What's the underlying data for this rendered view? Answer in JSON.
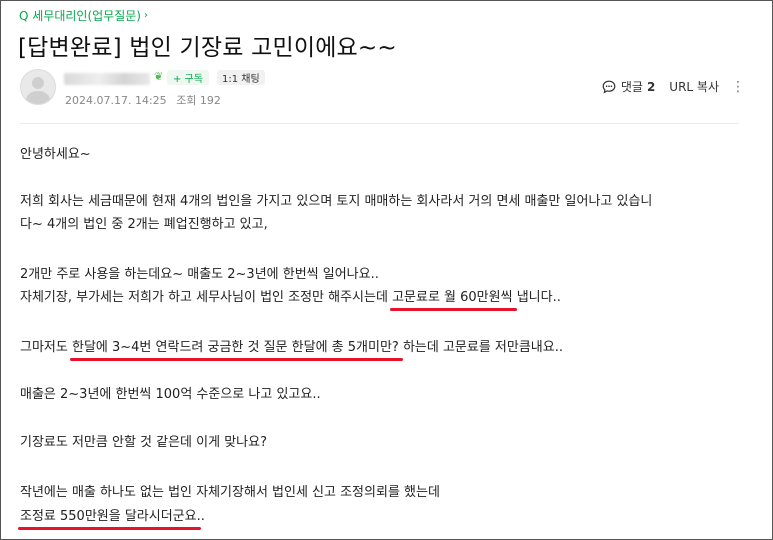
{
  "board": {
    "name": "Q 세무대리인(업무질문)",
    "chevron": "›"
  },
  "post": {
    "title": "[답변완료] 법인 기장료 고민이에요~~"
  },
  "author": {
    "follow_label": "+ 구독",
    "chat_label": "1:1 채팅",
    "date": "2024.07.17. 14:25",
    "views": "조회 192"
  },
  "actions": {
    "comment_label": "댓글",
    "comment_count": "2",
    "url_copy_label": "URL 복사",
    "more_label": "⋮"
  },
  "content": {
    "p1": "안녕하세요~",
    "p2_l1": "저희 회사는 세금때문에 현재 4개의 법인을 가지고 있으며 토지 매매하는 회사라서 거의 면세 매출만 일어나고 있습니",
    "p2_l2": "다~ 4개의 법인 중 2개는 폐업진행하고 있고,",
    "p3_l1": "2개만 주로 사용을 하는데요~ 매출도 2~3년에 한번씩 일어나요..",
    "p3_l2_pre": "자체기장, 부가세는 저희가 하고 세무사님이 법인 조정만 해주시는데 ",
    "p3_l2_hl": "고문료로 월 60만원씩",
    "p3_l2_post": " 냅니다..",
    "p4_pre": "그마저도 ",
    "p4_hl": "한달에 3~4번 연락드려 궁금한 것 질문 한달에 총 5개미만?",
    "p4_post": " 하는데 고문료를 저만큼내요..",
    "p5": "매출은 2~3년에 한번씩 100억 수준으로 나고 있고요..",
    "p6": "기장료도 저만큼 안할 것 같은데 이게 맞나요?",
    "p7_l1": "작년에는 매출 하나도 없는 법인 자체기장해서 법인세 신고 조정의뢰를 했는데",
    "p7_l2_hl": "조정료 550만원을 달라시더군요",
    "p7_l2_post": ".."
  },
  "colors": {
    "accent_green": "#03a94d",
    "highlight_red": "#e8122a"
  },
  "icons": {
    "avatar": "default-profile-avatar",
    "leaf": "leaf-icon",
    "comment": "comment-bubble-icon",
    "more": "more-vertical-icon"
  }
}
